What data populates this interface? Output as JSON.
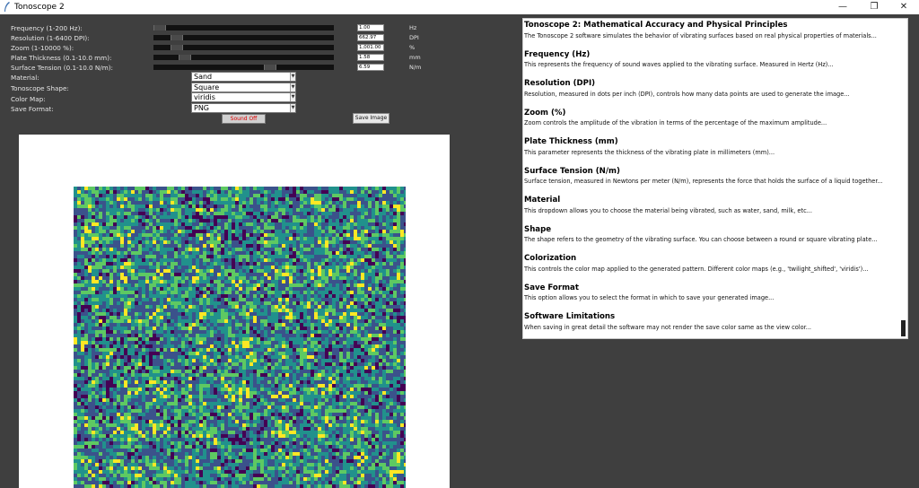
{
  "window": {
    "title": "Tonoscope 2",
    "minimize_icon": "—",
    "restore_icon": "❐",
    "close_icon": "✕"
  },
  "controls": {
    "sliders": [
      {
        "label": "Frequency (1-200 Hz):",
        "value": "1.00",
        "unit": "Hz",
        "level": 0.0
      },
      {
        "label": "Resolution (1-6400 DPI):",
        "value": "662.97",
        "unit": "DPI",
        "level": 0.1
      },
      {
        "label": "Zoom (1-10000 %):",
        "value": "1,001.00",
        "unit": "%",
        "level": 0.1
      },
      {
        "label": "Plate Thickness (0.1-10.0 mm):",
        "value": "1.58",
        "unit": "mm",
        "level": 0.15
      },
      {
        "label": "Surface Tension (0.1-10.0 N/m):",
        "value": "6.59",
        "unit": "N/m",
        "level": 0.66
      }
    ],
    "dropdowns": [
      {
        "label": "Material:",
        "value": "Sand"
      },
      {
        "label": "Tonoscope Shape:",
        "value": "Square"
      },
      {
        "label": "Color Map:",
        "value": "viridis"
      },
      {
        "label": "Save Format:",
        "value": "PNG"
      }
    ],
    "sound_button": "Sound Off",
    "save_button": "Save Image"
  },
  "info": {
    "sections": [
      {
        "title": "Tonoscope 2: Mathematical Accuracy and Physical Principles",
        "desc": "The Tonoscope 2 software simulates the behavior of vibrating surfaces based on real physical properties of materials..."
      },
      {
        "title": "Frequency (Hz)",
        "desc": "This represents the frequency of sound waves applied to the vibrating surface. Measured in Hertz (Hz)..."
      },
      {
        "title": "Resolution (DPI)",
        "desc": "Resolution, measured in dots per inch (DPI), controls how many data points are used to generate the image..."
      },
      {
        "title": "Zoom (%)",
        "desc": "Zoom controls the amplitude of the vibration in terms of the percentage of the maximum amplitude..."
      },
      {
        "title": "Plate Thickness (mm)",
        "desc": "This parameter represents the thickness of the vibrating plate in millimeters (mm)..."
      },
      {
        "title": "Surface Tension (N/m)",
        "desc": "Surface tension, measured in Newtons per meter (N/m), represents the force that holds the surface of a liquid together..."
      },
      {
        "title": "Material",
        "desc": "This dropdown allows you to choose the material being vibrated, such as water, sand, milk, etc..."
      },
      {
        "title": "Shape",
        "desc": "The shape refers to the geometry of the vibrating surface. You can choose between a round or square vibrating plate..."
      },
      {
        "title": "Colorization",
        "desc": "This controls the color map applied to the generated pattern. Different color maps (e.g., 'twilight_shifted', 'viridis')..."
      },
      {
        "title": "Save Format",
        "desc": "This option allows you to select the format in which to save your generated image..."
      },
      {
        "title": "Software Limitations",
        "desc": "When saving in great detail the software may not render the save color same as the view color..."
      }
    ]
  },
  "colors": {
    "background": "#3f3f3f",
    "sound_off_text": "#e00000",
    "viridis": [
      "#440154",
      "#3b528b",
      "#21918c",
      "#5ec962",
      "#fde725"
    ]
  },
  "icons": {
    "app": "feather-icon",
    "dropdown": "chevron-down-icon"
  }
}
